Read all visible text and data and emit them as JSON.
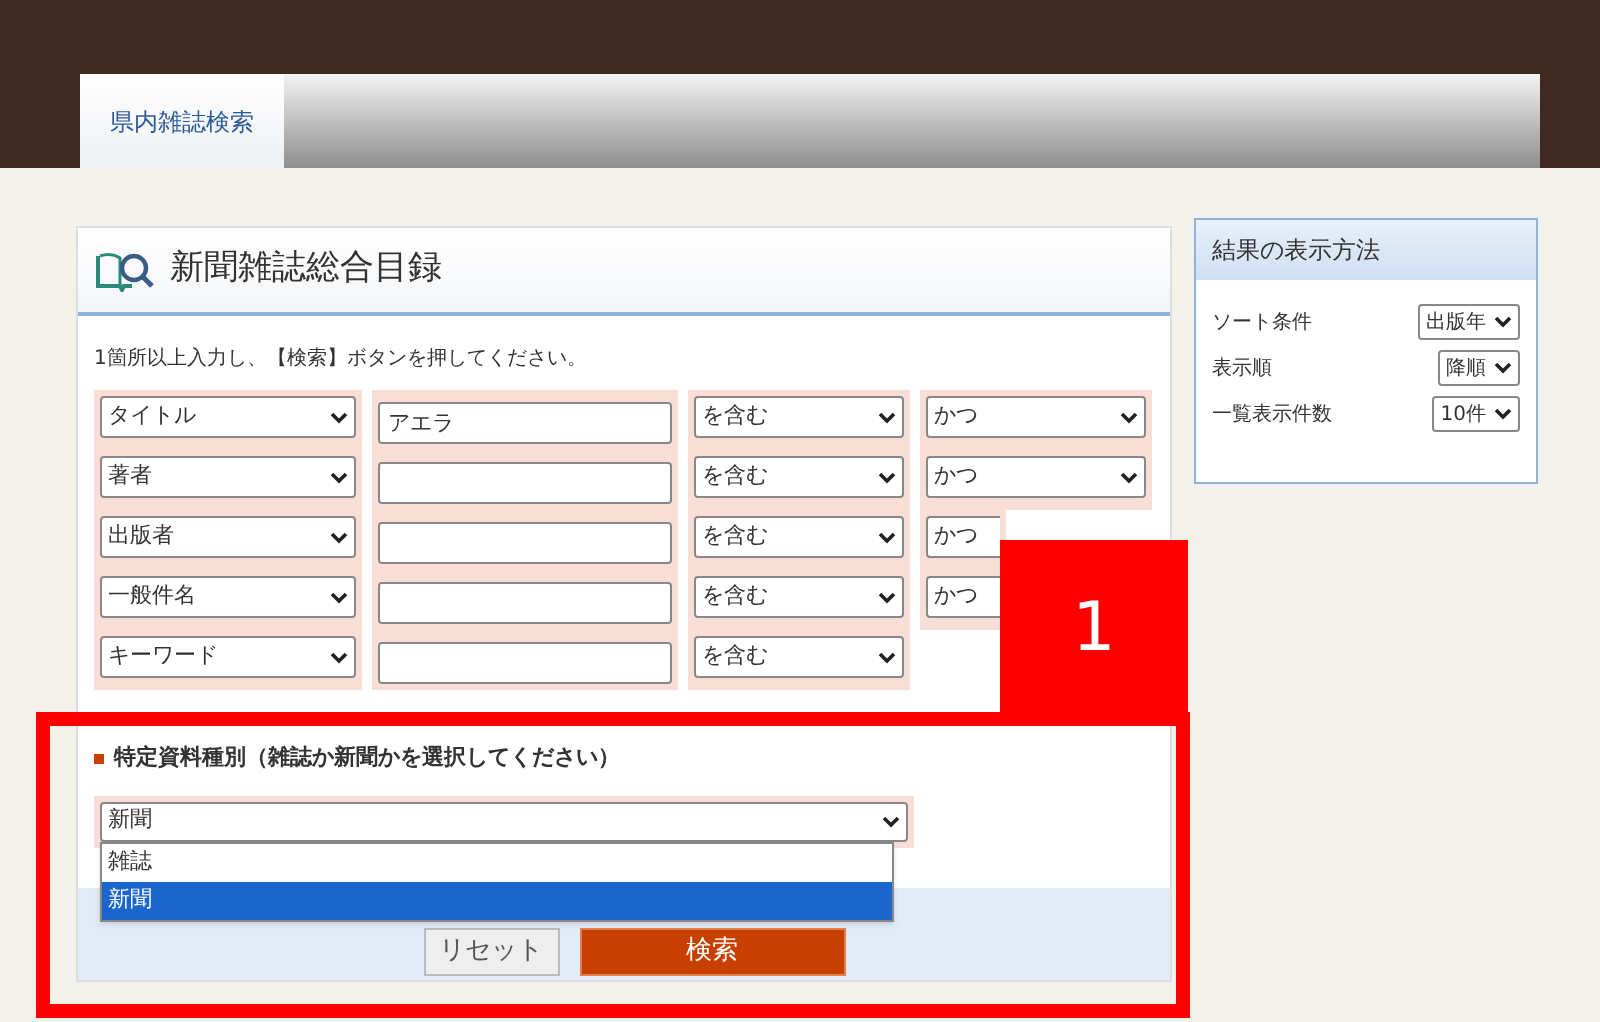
{
  "tabs": [
    {
      "label": "県内雑誌検索",
      "selected": true
    }
  ],
  "search_panel": {
    "title": "新聞雑誌総合目録",
    "instruction": "1箇所以上入力し、【検索】ボタンを押してください。",
    "rows": [
      {
        "field": "タイトル",
        "value": "アエラ",
        "match": "を含む",
        "operator": "かつ"
      },
      {
        "field": "著者",
        "value": "",
        "match": "を含む",
        "operator": "かつ"
      },
      {
        "field": "出版者",
        "value": "",
        "match": "を含む",
        "operator": "かつ"
      },
      {
        "field": "一般件名",
        "value": "",
        "match": "を含む",
        "operator": "かつ"
      },
      {
        "field": "キーワード",
        "value": "",
        "match": "を含む"
      }
    ],
    "material_type": {
      "heading": "特定資料種別（雑誌か新聞かを選択してください）",
      "value": "新聞",
      "expanded": true,
      "options": [
        {
          "label": "雑誌",
          "selected": false
        },
        {
          "label": "新聞",
          "selected": true
        }
      ]
    },
    "buttons": [
      {
        "label": "リセット",
        "kind": "secondary"
      },
      {
        "label": "検索",
        "kind": "primary"
      }
    ]
  },
  "display_options": {
    "title": "結果の表示方法",
    "rows": [
      {
        "label": "ソート条件",
        "value": "出版年"
      },
      {
        "label": "表示順",
        "value": "降順"
      },
      {
        "label": "一覧表示件数",
        "value": "10件"
      }
    ]
  },
  "annotation": {
    "label": "1"
  }
}
